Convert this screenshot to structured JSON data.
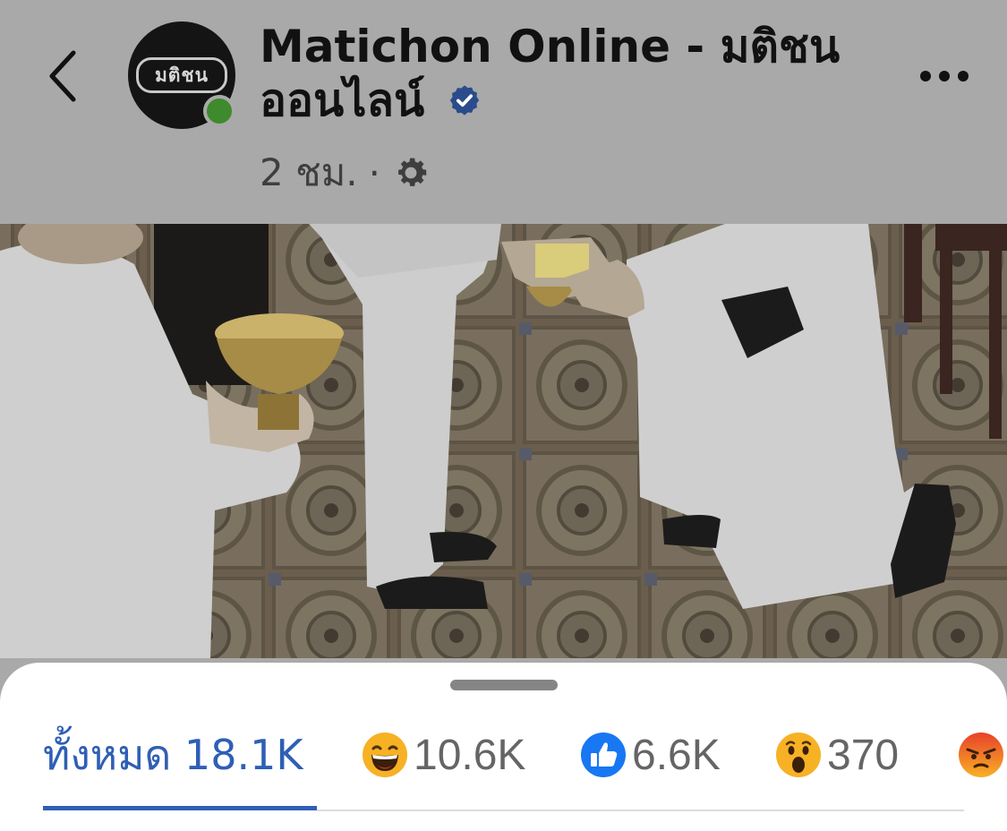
{
  "header": {
    "page_name": "Matichon Online - มติชนออนไลน์",
    "avatar_logo_text": "มติชน",
    "time": "2 ชม.",
    "separator": "·"
  },
  "reactions": {
    "tabs": [
      {
        "label": "ทั้งหมด 18.1K",
        "icon": null,
        "active": true
      },
      {
        "label": "10.6K",
        "icon": "haha-reaction-icon"
      },
      {
        "label": "6.6K",
        "icon": "like-reaction-icon"
      },
      {
        "label": "370",
        "icon": "wow-reaction-icon"
      },
      {
        "label": "",
        "icon": "angry-reaction-icon"
      }
    ]
  },
  "colors": {
    "accent": "#2f5fb5",
    "like_blue": "#1877f2",
    "emoji_yellow": "#f7b125",
    "angry_red": "#e9412a",
    "online_green": "#3f8a2d"
  }
}
